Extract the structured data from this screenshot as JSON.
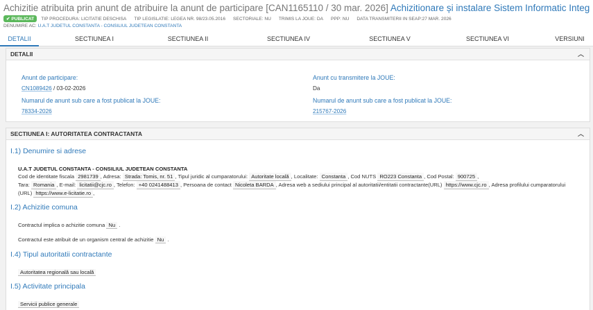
{
  "header": {
    "title_prefix": "Achizitie atribuita prin anunt de atribuire la anunt de participare [CAN1165110 / 30 mar. 2026]",
    "title_link": "Achizitionare și instalare Sistem Informatic Integrat (echip...",
    "badge": "PUBLICAT",
    "meta": [
      "TIP PROCEDURA: LICITATIE DESCHISA",
      "TIP LEGISLATIE: LEGEA NR. 98/23.05.2016",
      "SECTORIALE: NU",
      "TRIMIS LA JOUE: DA",
      "PPP: NU",
      "DATA TRANSMITERII IN SEAP:27 MAR. 2026"
    ],
    "ac_label": "DENUMIRE AC:",
    "ac_value": "U.A.T JUDETUL CONSTANTA - CONSILIUL JUDETEAN CONSTANTA"
  },
  "tabs": [
    "DETALII",
    "SECTIUNEA I",
    "SECTIUNEA II",
    "SECTIUNEA IV",
    "SECTIUNEA V",
    "SECTIUNEA VI",
    "VERSIUNI"
  ],
  "details": {
    "head": "DETALII",
    "anunt_participare_label": "Anunt de participare:",
    "anunt_participare_id": "CN1089426",
    "anunt_participare_date": "/ 03-02-2026",
    "nr_joue_label_left": "Numarul de anunt sub care a fost publicat la JOUE:",
    "nr_joue_left": "78334-2026",
    "transmitere_label": "Anunt cu transmitere la JOUE:",
    "transmitere_value": "Da",
    "nr_joue_label_right": "Numarul de anunt sub care a fost publicat la JOUE:",
    "nr_joue_right": "215767-2026"
  },
  "section1": {
    "head": "SECTIUNEA I: AUTORITATEA CONTRACTANTA",
    "s11_title": "I.1) Denumire si adrese",
    "org_name": "U.A.T JUDETUL CONSTANTA - CONSILIUL JUDETEAN CONSTANTA",
    "t_cod": "Cod de identitate fiscala",
    "v_cod": "2981739",
    "t_adresa": ", Adresa:",
    "v_adresa": "Strada: Tomis, nr. 51",
    "t_tip": ", Tipul juridic al cumparatorului:",
    "v_tip": "Autoritate locală",
    "t_loc": ", Localitate:",
    "v_loc": "Constanta",
    "t_nuts": ", Cod NUTS",
    "v_nuts": "RO223 Constanta",
    "t_postal": ", Cod Postal:",
    "v_postal": "900725",
    "t_end1": ",",
    "t_tara": "Tara:",
    "v_tara": "Romania",
    "t_email": ", E-mail:",
    "v_email": "licitatii@cjc.ro",
    "t_tel": ", Telefon:",
    "v_tel": "+40 0241488413",
    "t_pers": ", Persoana de contact",
    "v_pers": "Nicoleta BARDA",
    "t_web": ", Adresa web a sediului principal al autoritatii/entitatii contractante(URL)",
    "v_web": "https://www.cjc.ro",
    "t_profil": ", Adresa profilului cumparatorului (URL)",
    "v_profil": "https://www.e-licitatie.ro",
    "t_end2": ",",
    "s12_title": "I.2) Achizitie comuna",
    "comuna_text": "Contractul implica o achizitie comuna",
    "comuna_value": "Nu",
    "central_text": "Contractul este atribuit de un organism central de achizitie",
    "central_value": "Nu",
    "dot": ".",
    "s14_title": "I.4) Tipul autoritatii contractante",
    "tip_autoritate": "Autoritatea regională sau locală",
    "s15_title": "I.5) Activitate principala",
    "activitate": "Servicii publice generale"
  }
}
